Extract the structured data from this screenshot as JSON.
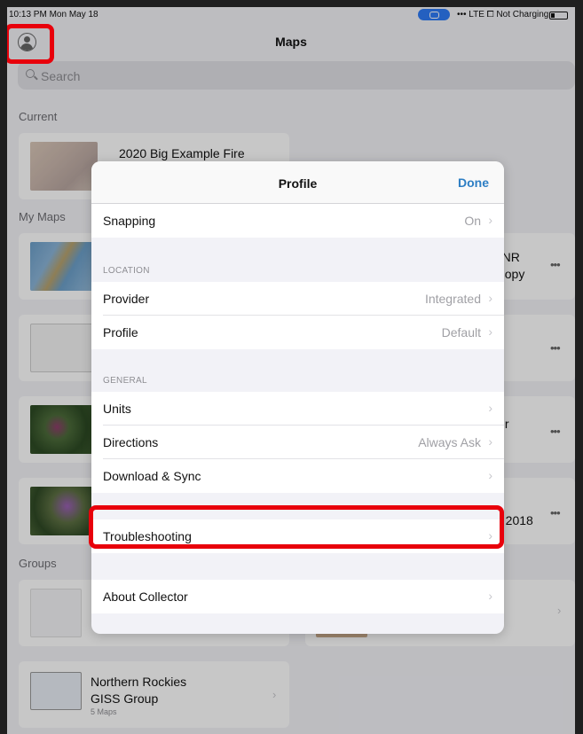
{
  "status_bar": {
    "time": "10:13 PM  Mon May 18",
    "right": "••• LTE  ⧠ Not Charging"
  },
  "header": {
    "title": "Maps",
    "search_placeholder": "Search"
  },
  "sections": {
    "current": "Current",
    "my_maps": "My Maps",
    "groups": "Groups"
  },
  "current_map": {
    "title": "2020 Big Example Fire"
  },
  "my_maps": [
    {
      "title_right": "0 NR\n-Copy"
    },
    {
      "title_right": ""
    },
    {
      "title_right": "air"
    },
    {
      "title_right": "e 2018"
    }
  ],
  "group": {
    "name": "Northern Rockies\nGISS Group",
    "count": "5 Maps"
  },
  "modal": {
    "title": "Profile",
    "done": "Done",
    "snapping": {
      "label": "Snapping",
      "value": "On"
    },
    "location_header": "LOCATION",
    "provider": {
      "label": "Provider",
      "value": "Integrated"
    },
    "profile": {
      "label": "Profile",
      "value": "Default"
    },
    "general_header": "GENERAL",
    "units": {
      "label": "Units",
      "value": ""
    },
    "directions": {
      "label": "Directions",
      "value": "Always Ask"
    },
    "download_sync": {
      "label": "Download & Sync",
      "value": ""
    },
    "troubleshooting": {
      "label": "Troubleshooting"
    },
    "about": {
      "label": "About Collector"
    }
  },
  "icons": {
    "chevron": "›",
    "more": "•••"
  },
  "colors": {
    "accent": "#2d7ec4",
    "highlight": "#e8000b"
  }
}
